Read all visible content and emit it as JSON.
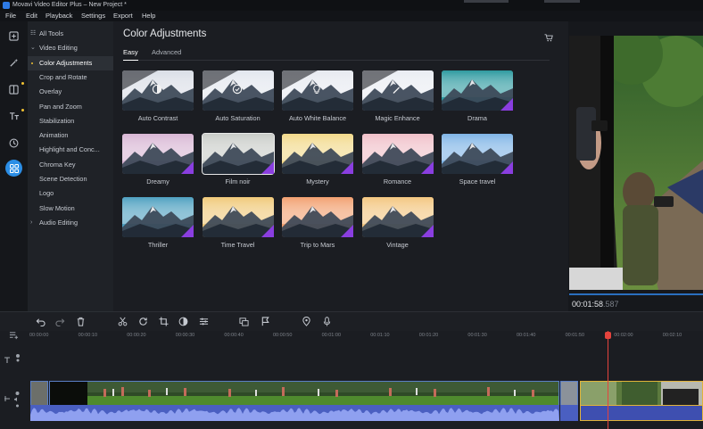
{
  "window": {
    "title": "Movavi Video Editor Plus – New Project *"
  },
  "menu": [
    "File",
    "Edit",
    "Playback",
    "Settings",
    "Export",
    "Help"
  ],
  "rail": [
    {
      "icon": "import-icon"
    },
    {
      "icon": "magic-wand-icon"
    },
    {
      "icon": "transitions-icon"
    },
    {
      "icon": "titles-icon"
    },
    {
      "icon": "stickers-icon"
    },
    {
      "icon": "more-tools-icon",
      "active": true
    }
  ],
  "tree": [
    {
      "label": "All Tools",
      "kind": "header"
    },
    {
      "label": "Video Editing",
      "kind": "group-open"
    },
    {
      "label": "Color Adjustments",
      "kind": "item",
      "active": true
    },
    {
      "label": "Crop and Rotate",
      "kind": "item"
    },
    {
      "label": "Overlay",
      "kind": "item"
    },
    {
      "label": "Pan and Zoom",
      "kind": "item"
    },
    {
      "label": "Stabilization",
      "kind": "item"
    },
    {
      "label": "Animation",
      "kind": "item"
    },
    {
      "label": "Highlight and Conc...",
      "kind": "item"
    },
    {
      "label": "Chroma Key",
      "kind": "item"
    },
    {
      "label": "Scene Detection",
      "kind": "item"
    },
    {
      "label": "Logo",
      "kind": "item"
    },
    {
      "label": "Slow Motion",
      "kind": "item"
    },
    {
      "label": "Audio Editing",
      "kind": "group-closed"
    }
  ],
  "panel": {
    "title": "Color Adjustments",
    "tabs": [
      {
        "label": "Easy",
        "active": true
      },
      {
        "label": "Advanced"
      }
    ]
  },
  "presets": [
    {
      "label": "Auto Contrast",
      "tint": "#d9dde6",
      "icon": "contrast-icon",
      "auto": true
    },
    {
      "label": "Auto Saturation",
      "tint": "#e2e6ee",
      "icon": "saturation-icon",
      "auto": true
    },
    {
      "label": "Auto White Balance",
      "tint": "#e6e9f0",
      "icon": "bulb-icon",
      "auto": true
    },
    {
      "label": "Magic Enhance",
      "tint": "#e9ecf2",
      "icon": "wand-icon",
      "auto": true
    },
    {
      "label": "Drama",
      "tint": "#2e9aa0",
      "premium": true
    },
    {
      "label": "Dreamy",
      "tint": "#d8b6d4",
      "premium": true
    },
    {
      "label": "Film noir",
      "tint": "#c9ccc8",
      "premium": true,
      "selected": true
    },
    {
      "label": "Mystery",
      "tint": "#f2d98a",
      "premium": true
    },
    {
      "label": "Romance",
      "tint": "#f0bfc8",
      "premium": true
    },
    {
      "label": "Space travel",
      "tint": "#7fb4e6",
      "premium": true
    },
    {
      "label": "Thriller",
      "tint": "#4ea0c0",
      "premium": true
    },
    {
      "label": "Time Travel",
      "tint": "#f0c97a",
      "premium": true
    },
    {
      "label": "Trip to Mars",
      "tint": "#f2a070",
      "premium": true
    },
    {
      "label": "Vintage",
      "tint": "#f3c680",
      "premium": true
    }
  ],
  "preview": {
    "timecode": "00:01:58",
    "frames": ".587"
  },
  "ruler": [
    "00:00:00",
    "00:00:10",
    "00:00:20",
    "00:00:30",
    "00:00:40",
    "00:00:50",
    "00:01:00",
    "00:01:10",
    "00:01:20",
    "00:01:30",
    "00:01:40",
    "00:01:50",
    "00:02:00",
    "00:02:10"
  ],
  "toolbar": [
    "undo-icon",
    "redo-icon",
    "delete-icon",
    "cut-icon",
    "rotate-icon",
    "crop-icon",
    "color-icon",
    "settings-sliders-icon",
    "insert-icon",
    "flag-icon",
    "marker-icon",
    "mic-icon"
  ]
}
